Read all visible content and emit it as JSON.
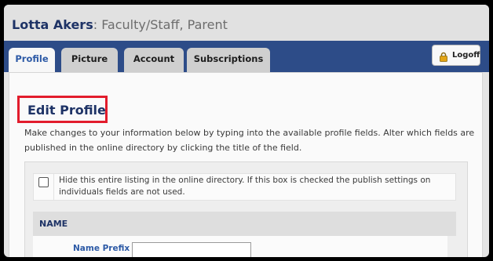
{
  "header": {
    "user_name": "Lotta Akers",
    "roles": ": Faculty/Staff, Parent"
  },
  "tabs": [
    {
      "label": "Profile",
      "active": true
    },
    {
      "label": "Picture",
      "active": false
    },
    {
      "label": "Account",
      "active": false
    },
    {
      "label": "Subscriptions",
      "active": false
    }
  ],
  "logoff": {
    "label": "Logoff",
    "icon": "lock-icon"
  },
  "page": {
    "title": "Edit Profile",
    "intro": "Make changes to your information below by typing into the available profile fields. Alter which fields are published in the online directory by clicking the title of the field."
  },
  "form": {
    "hide_listing": {
      "checked": false,
      "text": "Hide this entire listing in the online directory. If this box is checked the publish settings on individuals fields are not used."
    },
    "section_title": "NAME",
    "fields": [
      {
        "label": "Name Prefix",
        "value": "",
        "placeholder": ""
      }
    ]
  },
  "colors": {
    "nav": "#2d4c88",
    "title": "#1e3366",
    "link": "#2d5aa6",
    "highlight": "#e21c2c"
  }
}
